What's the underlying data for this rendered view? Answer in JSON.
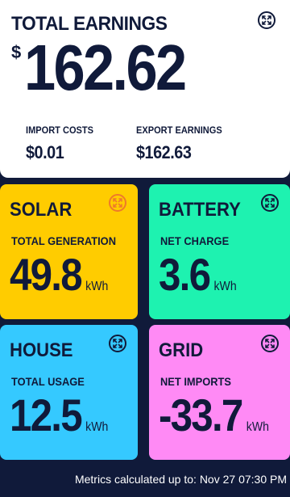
{
  "colors": {
    "background": "#101a3a",
    "summary": "#ffffff",
    "solar": "#ffcc00",
    "battery": "#1ef2b0",
    "house": "#35c9ff",
    "grid": "#ff8af5",
    "text": "#101a3a"
  },
  "summary": {
    "title": "TOTAL EARNINGS",
    "currency": "$",
    "total": "162.62",
    "import_label": "IMPORT COSTS",
    "import_value": "$0.01",
    "export_label": "EXPORT EARNINGS",
    "export_value": "$162.63",
    "icon": "expand-icon"
  },
  "tiles": {
    "solar": {
      "title": "SOLAR",
      "label": "TOTAL GENERATION",
      "value": "49.8",
      "unit": "kWh",
      "icon": "expand-icon"
    },
    "battery": {
      "title": "BATTERY",
      "label": "NET CHARGE",
      "value": "3.6",
      "unit": "kWh",
      "icon": "expand-icon"
    },
    "house": {
      "title": "HOUSE",
      "label": "TOTAL USAGE",
      "value": "12.5",
      "unit": "kWh",
      "icon": "expand-icon"
    },
    "grid": {
      "title": "GRID",
      "label": "NET IMPORTS",
      "value": "-33.7",
      "unit": "kWh",
      "icon": "expand-icon"
    }
  },
  "footer": "Metrics calculated up to: Nov 27 07:30 PM"
}
